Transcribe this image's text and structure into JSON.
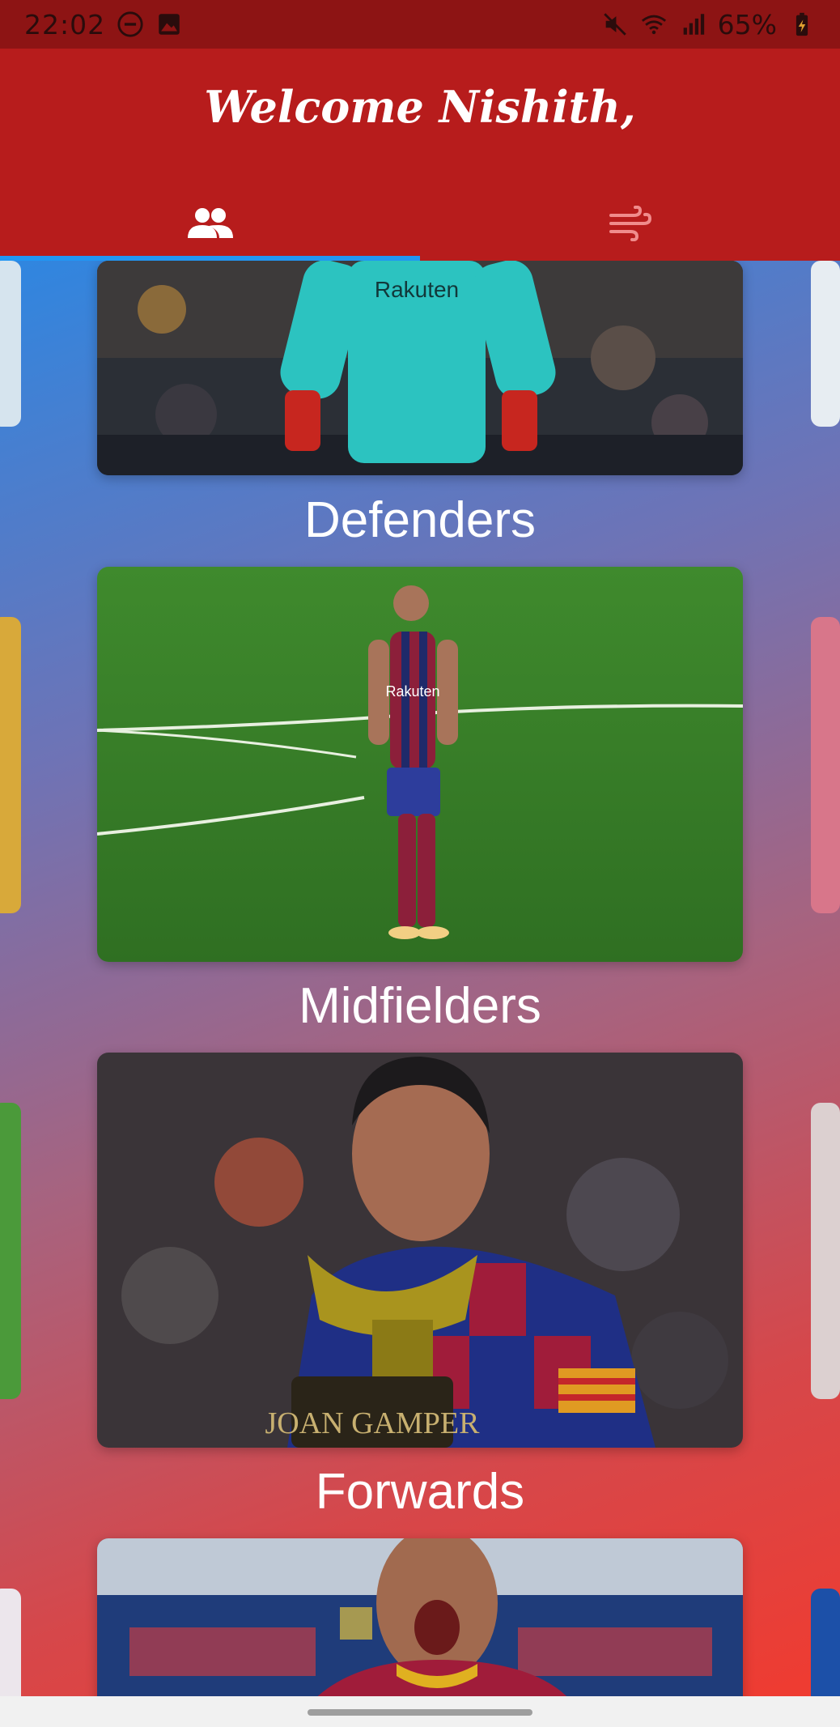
{
  "status_bar": {
    "time": "22:02",
    "battery": "65%",
    "icons": [
      "do-not-disturb-icon",
      "image-icon",
      "mute-icon",
      "wifi-icon",
      "signal-icon",
      "battery-icon"
    ]
  },
  "app_bar": {
    "welcome": "Welcome Nishith,",
    "tabs": [
      {
        "icon": "people-icon",
        "selected": true
      },
      {
        "icon": "wind-icon",
        "selected": false
      }
    ],
    "colors": {
      "bar": "#b71c1c",
      "indicator": "#2196f3"
    }
  },
  "sections": [
    {
      "label": "Defenders"
    },
    {
      "label": "Midfielders"
    },
    {
      "label": "Forwards"
    }
  ]
}
